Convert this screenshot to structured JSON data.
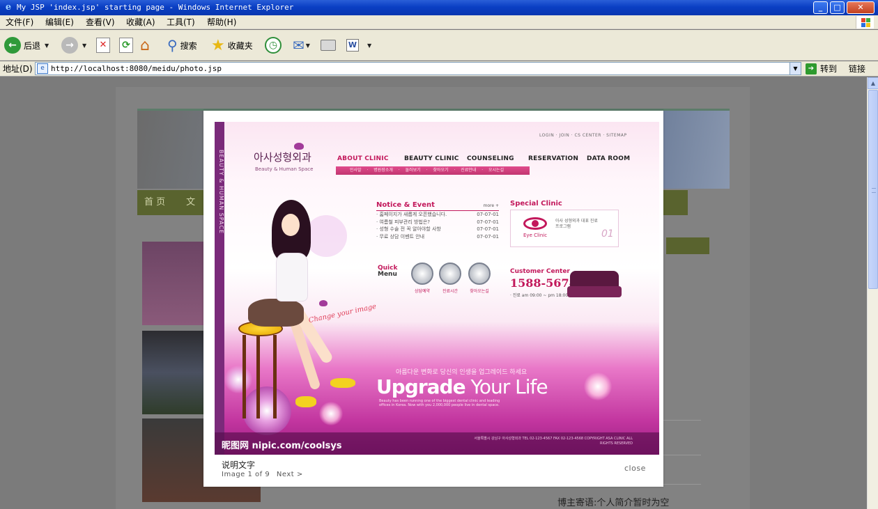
{
  "window": {
    "title": "My JSP 'index.jsp' starting page - Windows Internet Explorer",
    "minimize_label": "_",
    "maximize_label": "□",
    "close_label": "✕"
  },
  "menubar": {
    "items": [
      "文件(F)",
      "编辑(E)",
      "查看(V)",
      "收藏(A)",
      "工具(T)",
      "帮助(H)"
    ]
  },
  "toolbar": {
    "back_label": "后退",
    "search_label": "搜索",
    "favorites_label": "收藏夹"
  },
  "addressbar": {
    "label": "地址(D)",
    "url": "http://localhost:8080/meidu/photo.jsp",
    "go_label": "转到",
    "links_label": "链接"
  },
  "page": {
    "nav_items": [
      "首 页",
      "文"
    ],
    "footer_text": "博主寄语:个人简介暂时为空"
  },
  "lightbox": {
    "caption": "说明文字",
    "counter": "Image 1 of 9",
    "next_label": "Next >",
    "close_label": "close",
    "image": {
      "logo": "아사성형외과",
      "logo_sub": "Beauty & Human Space",
      "sidebar_text": "BEAUTY & HUMAN SPACE",
      "top_links": "LOGIN · JOIN · CS CENTER · SITEMAP",
      "nav": [
        "ABOUT CLINIC",
        "BEAUTY CLINIC",
        "COUNSELING",
        "RESERVATION",
        "DATA ROOM"
      ],
      "subnav": "인사말 · 병원장소개 · 둘러보기 · 찾아오기 · 진료안내 · 오시는길",
      "notice_title": "Notice & Event",
      "notice_more": "more +",
      "notice_rows": [
        {
          "text": "· 홈페이지가 새롭게 오픈했습니다.",
          "date": "07-07-01"
        },
        {
          "text": "· 여름철 피부관리 방법은?",
          "date": "07-07-01"
        },
        {
          "text": "· 성형 수술 전 꼭 알아야할 사항",
          "date": "07-07-01"
        },
        {
          "text": "· 무료 상담 이벤트 안내",
          "date": "07-07-01"
        }
      ],
      "special_title": "Special Clinic",
      "special_caption": "Eye Clinic",
      "special_num": "01",
      "special_desc": "아사 성형외과 대표 진료 프로그램",
      "quick_q": "Quick",
      "quick_menu": "Menu",
      "quick_icons": [
        "상담예약",
        "진료시간",
        "찾아오는길"
      ],
      "cc_title": "Customer Center",
      "cc_phone": "1588-5678",
      "cc_hours": "· 진료 am 09:00 ~ pm 18:00",
      "tagline": "Change your image",
      "kr_line": "아름다운 변화로 당신의 인생을 업그레이드 하세요",
      "headline_bold": "Upgrade",
      "headline_light": " Your Life",
      "small_copy": "Beauty has been running one of the biggest dental clinic and leading offices in Korea. Now with you 2,000,000 people live in dental space.",
      "watermark": "昵图网 nipic.com/coolsys",
      "footer_right": "서울특별시 강남구 아사성형외과 TEL 02-123-4567 FAX 02-123-4568 COPYRIGHT ASA CLINIC ALL RIGHTS RESERVED"
    }
  }
}
